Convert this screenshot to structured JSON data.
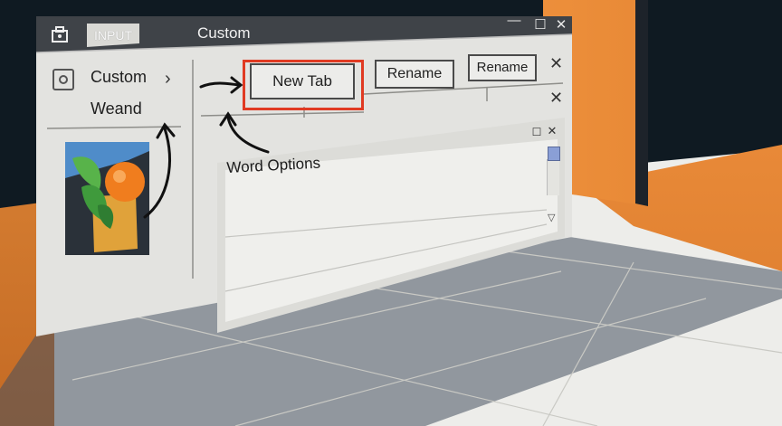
{
  "window": {
    "tab_label": "INPUT",
    "title": "Custom",
    "controls": {
      "minimize": "—",
      "maximize": "☐",
      "close": "✕"
    }
  },
  "sidebar": {
    "items": [
      {
        "label": "Custom"
      },
      {
        "label": "Weand"
      }
    ],
    "chevron": "›"
  },
  "toolbar": {
    "new_tab_label": "New Tab",
    "rename_label_1": "Rename",
    "rename_label_2": "Rename",
    "close_glyph": "✕"
  },
  "dialog": {
    "title": "Word Options",
    "controls": {
      "maximize": "☐",
      "close": "✕"
    },
    "scroll_down": "▽"
  },
  "colors": {
    "highlight": "#e03a22",
    "titlebar": "#3f4348",
    "wall": "#f0933f",
    "scroll_thumb": "#8a9fd6"
  },
  "icons": [
    "app-briefcase-icon",
    "pane-icon",
    "chevron-right-icon",
    "close-icon",
    "maximize-icon",
    "minimize-icon",
    "arrow-icon"
  ]
}
